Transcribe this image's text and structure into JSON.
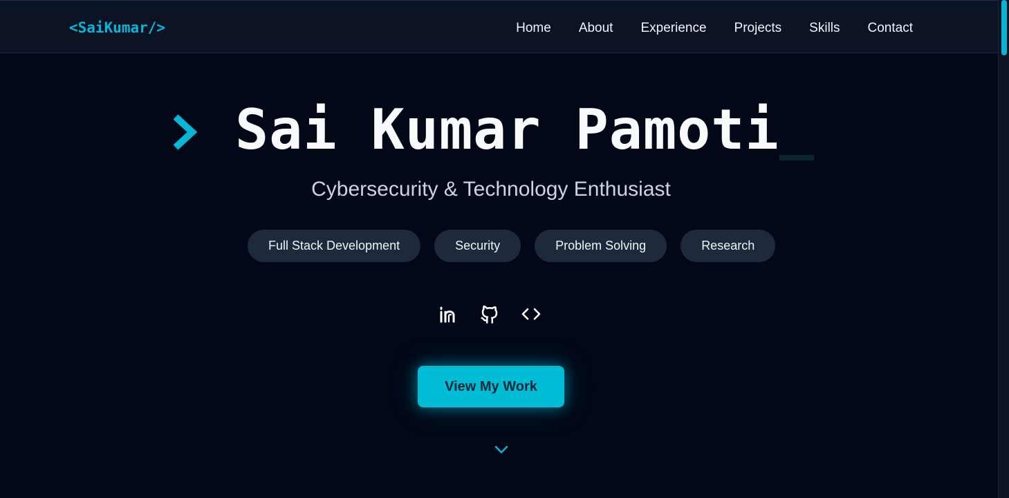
{
  "colors": {
    "background": "#020817",
    "navbar": "#0b1324",
    "accent": "#06b6d4",
    "tag_background": "#1e293b",
    "text": "#f8fafc",
    "subtitle": "#cbd5e1"
  },
  "navbar": {
    "logo": "<SaiKumar/>",
    "links": [
      "Home",
      "About",
      "Experience",
      "Projects",
      "Skills",
      "Contact"
    ]
  },
  "hero": {
    "prompt_icon": "chevron-right-icon",
    "name": "Sai Kumar Pamoti",
    "subtitle": "Cybersecurity & Technology Enthusiast",
    "tags": [
      "Full Stack Development",
      "Security",
      "Problem Solving",
      "Research"
    ],
    "socials": [
      {
        "icon": "linkedin-icon"
      },
      {
        "icon": "github-icon"
      },
      {
        "icon": "code-icon"
      }
    ],
    "cta_label": "View My Work",
    "scroll_icon": "chevron-down-icon"
  }
}
